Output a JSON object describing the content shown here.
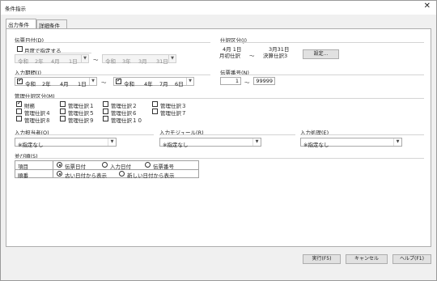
{
  "window": {
    "title": "条件指示"
  },
  "tabs": [
    {
      "label": "出力条件",
      "active": true
    },
    {
      "label": "詳細条件",
      "active": false
    }
  ],
  "voucher_date": {
    "label": "伝票日付(D)",
    "month_checkbox_label": "月度で指定する",
    "from": {
      "era": "令和",
      "year": "2年",
      "month": "4月",
      "day": "1日"
    },
    "tilde": "～",
    "to": {
      "era": "令和",
      "year": "3年",
      "month": "3月",
      "day": "31日"
    }
  },
  "journal_class": {
    "label": "仕訳区分(J)",
    "from_date": "4月 1日",
    "from_type": "月初仕訳",
    "tilde": "～",
    "to_date": "3月31日",
    "to_type": "決算仕訳3",
    "settings_button": "設定..."
  },
  "input_period": {
    "label": "入力期間(I)",
    "from": {
      "checked": true,
      "era": "令和",
      "year": "2年",
      "month": "4月",
      "day": "1日"
    },
    "tilde": "～",
    "to": {
      "checked": true,
      "era": "令和",
      "year": "4年",
      "month": "7月",
      "day": "6日"
    }
  },
  "voucher_number": {
    "label": "伝票番号(N)",
    "from": "1",
    "tilde": "～",
    "to": "99999"
  },
  "management_class": {
    "label": "管理仕訳区分(M)",
    "items": [
      {
        "label": "財務",
        "checked": true
      },
      {
        "label": "管理仕訳１",
        "checked": false
      },
      {
        "label": "管理仕訳２",
        "checked": false
      },
      {
        "label": "管理仕訳３",
        "checked": false
      },
      {
        "label": "管理仕訳４",
        "checked": false
      },
      {
        "label": "管理仕訳５",
        "checked": false
      },
      {
        "label": "管理仕訳６",
        "checked": false
      },
      {
        "label": "管理仕訳７",
        "checked": false
      },
      {
        "label": "管理仕訳８",
        "checked": false
      },
      {
        "label": "管理仕訳９",
        "checked": false
      },
      {
        "label": "管理仕訳１０",
        "checked": false
      }
    ]
  },
  "input_person": {
    "label": "入力担当者(O)",
    "value": "※指定なし"
  },
  "input_module": {
    "label": "入力モジュール(R)",
    "value": "※指定なし"
  },
  "input_process": {
    "label": "入力処理(E)",
    "value": "※指定なし"
  },
  "sort_order": {
    "label": "並び順(S)",
    "rows": [
      {
        "header": "項目",
        "options": [
          "伝票日付",
          "入力日付",
          "伝票番号"
        ],
        "selected": 0
      },
      {
        "header": "順番",
        "options": [
          "古い日付から表示",
          "新しい日付から表示"
        ],
        "selected": 0
      }
    ]
  },
  "footer": {
    "execute_button": "実行(F5)",
    "cancel_button": "キャンセル",
    "help_button": "ヘルプ(F1)"
  }
}
